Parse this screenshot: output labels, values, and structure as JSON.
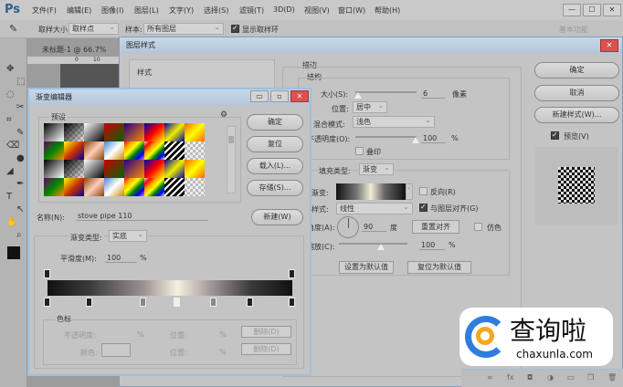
{
  "app": {
    "logo": "Ps",
    "menu": [
      "文件(F)",
      "编辑(E)",
      "图像(I)",
      "图层(L)",
      "文字(Y)",
      "选择(S)",
      "滤镜(T)",
      "3D(D)",
      "视图(V)",
      "窗口(W)",
      "帮助(H)"
    ],
    "win_min": "—",
    "win_max": "☐",
    "win_close": "✕"
  },
  "options": {
    "sample_size_label": "取样大小:",
    "sample_size": "取样点",
    "sample_label": "样本:",
    "sample": "所有图层",
    "show_ring": "显示取样环",
    "show_ring_checked": true,
    "workspace": "基本功能"
  },
  "document": {
    "tab": "未标题-1 @ 66.7%",
    "ruler": [
      "0",
      "10"
    ]
  },
  "layer_style": {
    "title": "图层样式",
    "left_header": "样式",
    "section": "描边",
    "structure": "结构",
    "size_label": "大小(S):",
    "size": "6",
    "size_unit": "像素",
    "size_slider": 6,
    "position_label": "位置:",
    "position": "居中",
    "blend_label": "混合模式:",
    "blend": "浅色",
    "opacity_label": "不透明度(O):",
    "opacity": "100",
    "opacity_unit": "%",
    "overprint": "叠印",
    "overprint_checked": false,
    "fill_type_label": "填充类型:",
    "fill_type": "渐变",
    "gradient_label": "渐变:",
    "reverse": "反向(R)",
    "reverse_checked": false,
    "style_label": "样式:",
    "style": "线性",
    "align": "与图层对齐(G)",
    "align_checked": true,
    "angle_label": "角度(A):",
    "angle": "90",
    "angle_unit": "度",
    "reset_align": "重置对齐",
    "dither": "仿色",
    "dither_checked": false,
    "scale_label": "缩放(C):",
    "scale": "100",
    "scale_unit": "%",
    "set_default": "设置为默认值",
    "reset_default": "复位为默认值",
    "ok": "确定",
    "cancel": "取消",
    "new_style": "新建样式(W)...",
    "preview": "预览(V)",
    "preview_checked": true
  },
  "gradient_editor": {
    "title": "渐变编辑器",
    "presets_label": "预设",
    "ok": "确定",
    "reset": "复位",
    "load": "载入(L)...",
    "save": "存储(S)...",
    "name_label": "名称(N):",
    "name": "stove pipe 110",
    "new": "新建(W)",
    "type_label": "渐变类型:",
    "type": "实底",
    "smooth_label": "平滑度(M):",
    "smooth": "100",
    "smooth_unit": "%",
    "color_stops_positions": [
      0,
      17,
      39,
      53,
      68,
      83,
      100
    ],
    "opacity_stops_positions": [
      0,
      100
    ],
    "stops_group": "色标",
    "opacity_label": "不透明度:",
    "pct": "%",
    "location_label": "位置:",
    "delete": "删除(D)",
    "color_label": "颜色:"
  },
  "watermark": {
    "name": "查询啦",
    "url": "chaxunla.com"
  },
  "colors": {
    "accent": "#7f9fbf",
    "close": "#d9534f"
  }
}
